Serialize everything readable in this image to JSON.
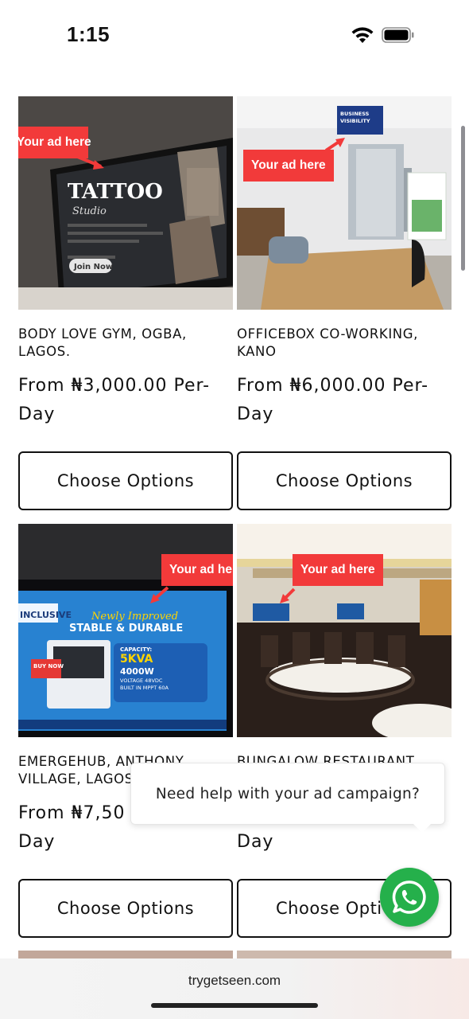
{
  "status_bar": {
    "time": "1:15"
  },
  "site": {
    "url": "trygetseen.com"
  },
  "ad_overlay_label": "Your ad here",
  "products": [
    {
      "title": "BODY LOVE GYM, OGBA, LAGOS.",
      "price": "From ₦3,000.00 Per-Day",
      "button": "Choose Options",
      "image_text": [
        "TATTOO",
        "Studio",
        "Join Now"
      ]
    },
    {
      "title": "OFFICEBOX CO-WORKING, KANO",
      "price": "From ₦6,000.00 Per-Day",
      "button": "Choose Options",
      "image_text": [
        "BUSINESS",
        "VISIBILITY"
      ]
    },
    {
      "title": "EMERGEHUB, ANTHONY VILLAGE, LAGOS",
      "price": "From ₦7,50",
      "price_line2": "Day",
      "button": "Choose Options",
      "image_text": [
        "INCLUSIVE",
        "Newly Improved",
        "STABLE & DURABLE",
        "CAPACITY:",
        "5KVA",
        "4000W",
        "VOLTAGE 48VDC",
        "BUILT IN MPPT 60A",
        "BUY NOW"
      ]
    },
    {
      "title": "BUNGALOW RESTAURANT",
      "price_line2": "Day",
      "button": "Choose Opti"
    }
  ],
  "help_bubble": {
    "text": "Need help with your ad campaign?"
  },
  "whatsapp": {
    "icon": "whatsapp-icon",
    "color": "#25b04b"
  }
}
